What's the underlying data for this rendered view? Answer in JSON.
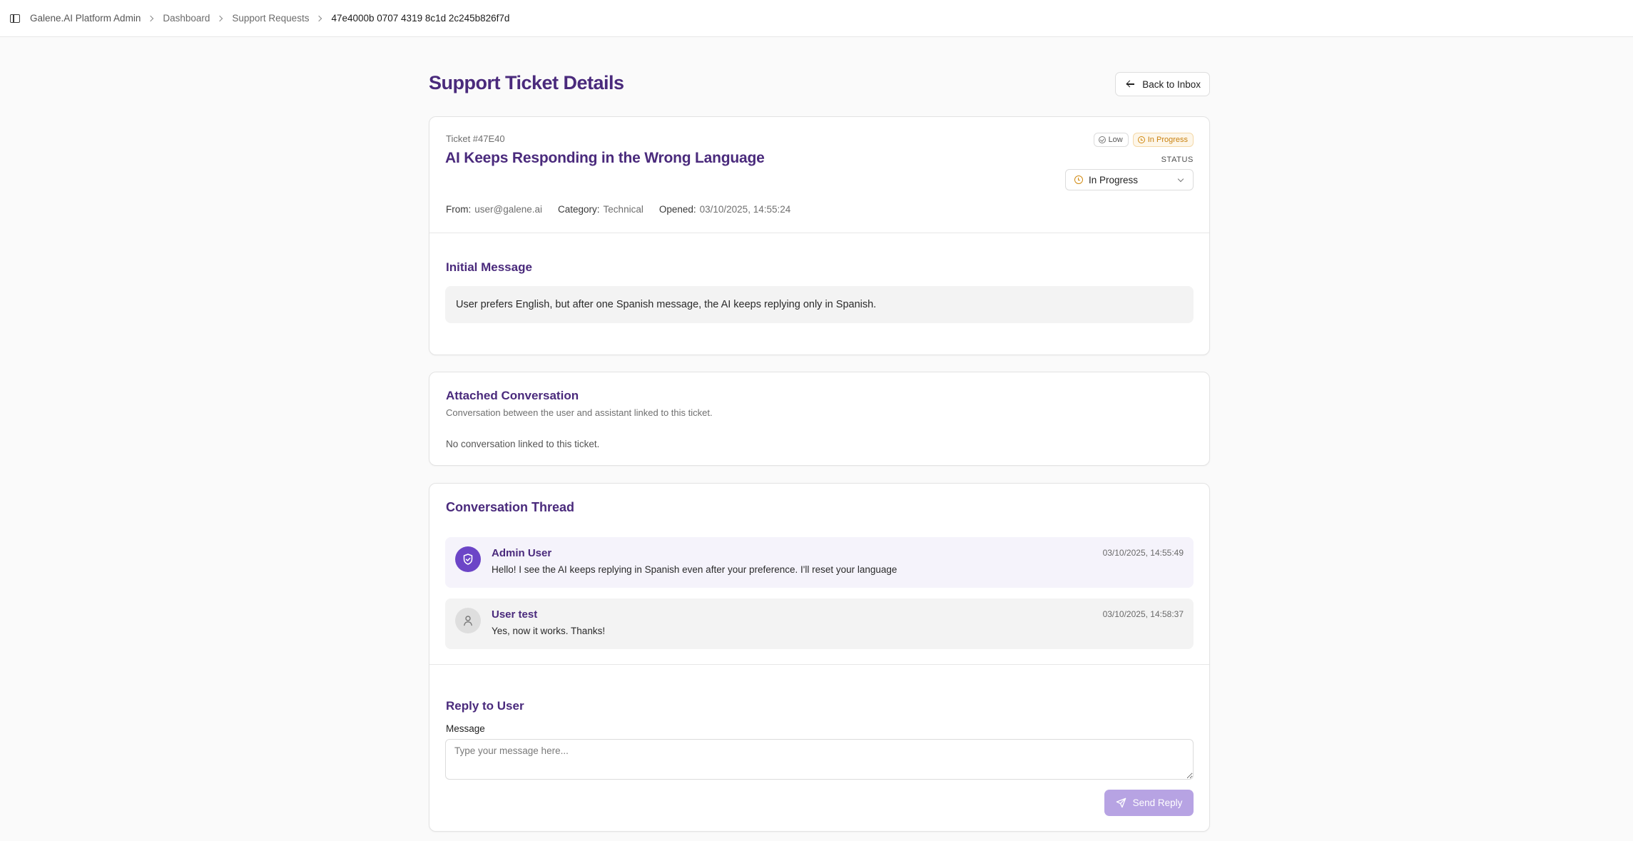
{
  "breadcrumb": {
    "app": "Galene.AI Platform Admin",
    "items": [
      "Dashboard",
      "Support Requests"
    ],
    "current": "47e4000b 0707 4319 8c1d 2c245b826f7d"
  },
  "page": {
    "title": "Support Ticket Details",
    "back_label": "Back to Inbox"
  },
  "ticket": {
    "id_label": "Ticket #47E40",
    "title": "AI Keeps Responding in the Wrong Language",
    "priority_badge": "Low",
    "status_badge": "In Progress",
    "status_label": "STATUS",
    "status_value": "In Progress",
    "meta": {
      "from_key": "From:",
      "from_val": "user@galene.ai",
      "category_key": "Category:",
      "category_val": "Technical",
      "opened_key": "Opened:",
      "opened_val": "03/10/2025, 14:55:24"
    },
    "initial_title": "Initial Message",
    "initial_message": "User prefers English, but after one Spanish message, the AI keeps replying only in Spanish."
  },
  "attached": {
    "title": "Attached Conversation",
    "subtitle": "Conversation between the user and assistant linked to this ticket.",
    "empty": "No conversation linked to this ticket."
  },
  "thread": {
    "title": "Conversation Thread",
    "messages": [
      {
        "author": "Admin User",
        "text": "Hello! I see the AI keeps replying in Spanish even after your preference. I'll reset your language",
        "time": "03/10/2025, 14:55:49"
      },
      {
        "author": "User test",
        "text": "Yes, now it works. Thanks!",
        "time": "03/10/2025, 14:58:37"
      }
    ]
  },
  "reply": {
    "title": "Reply to User",
    "field_label": "Message",
    "placeholder": "Type your message here...",
    "value": "",
    "send_label": "Send Reply"
  },
  "colors": {
    "accent": "#4a2a7c",
    "admin_avatar": "#6c45c7",
    "send_button": "#b7a3e3",
    "status_amber": "#d18a12"
  },
  "icons": [
    "sidebar-toggle-icon",
    "chevron-right-icon",
    "arrow-left-icon",
    "check-circle-icon",
    "clock-icon",
    "chevron-down-icon",
    "shield-icon",
    "user-icon",
    "send-icon"
  ]
}
